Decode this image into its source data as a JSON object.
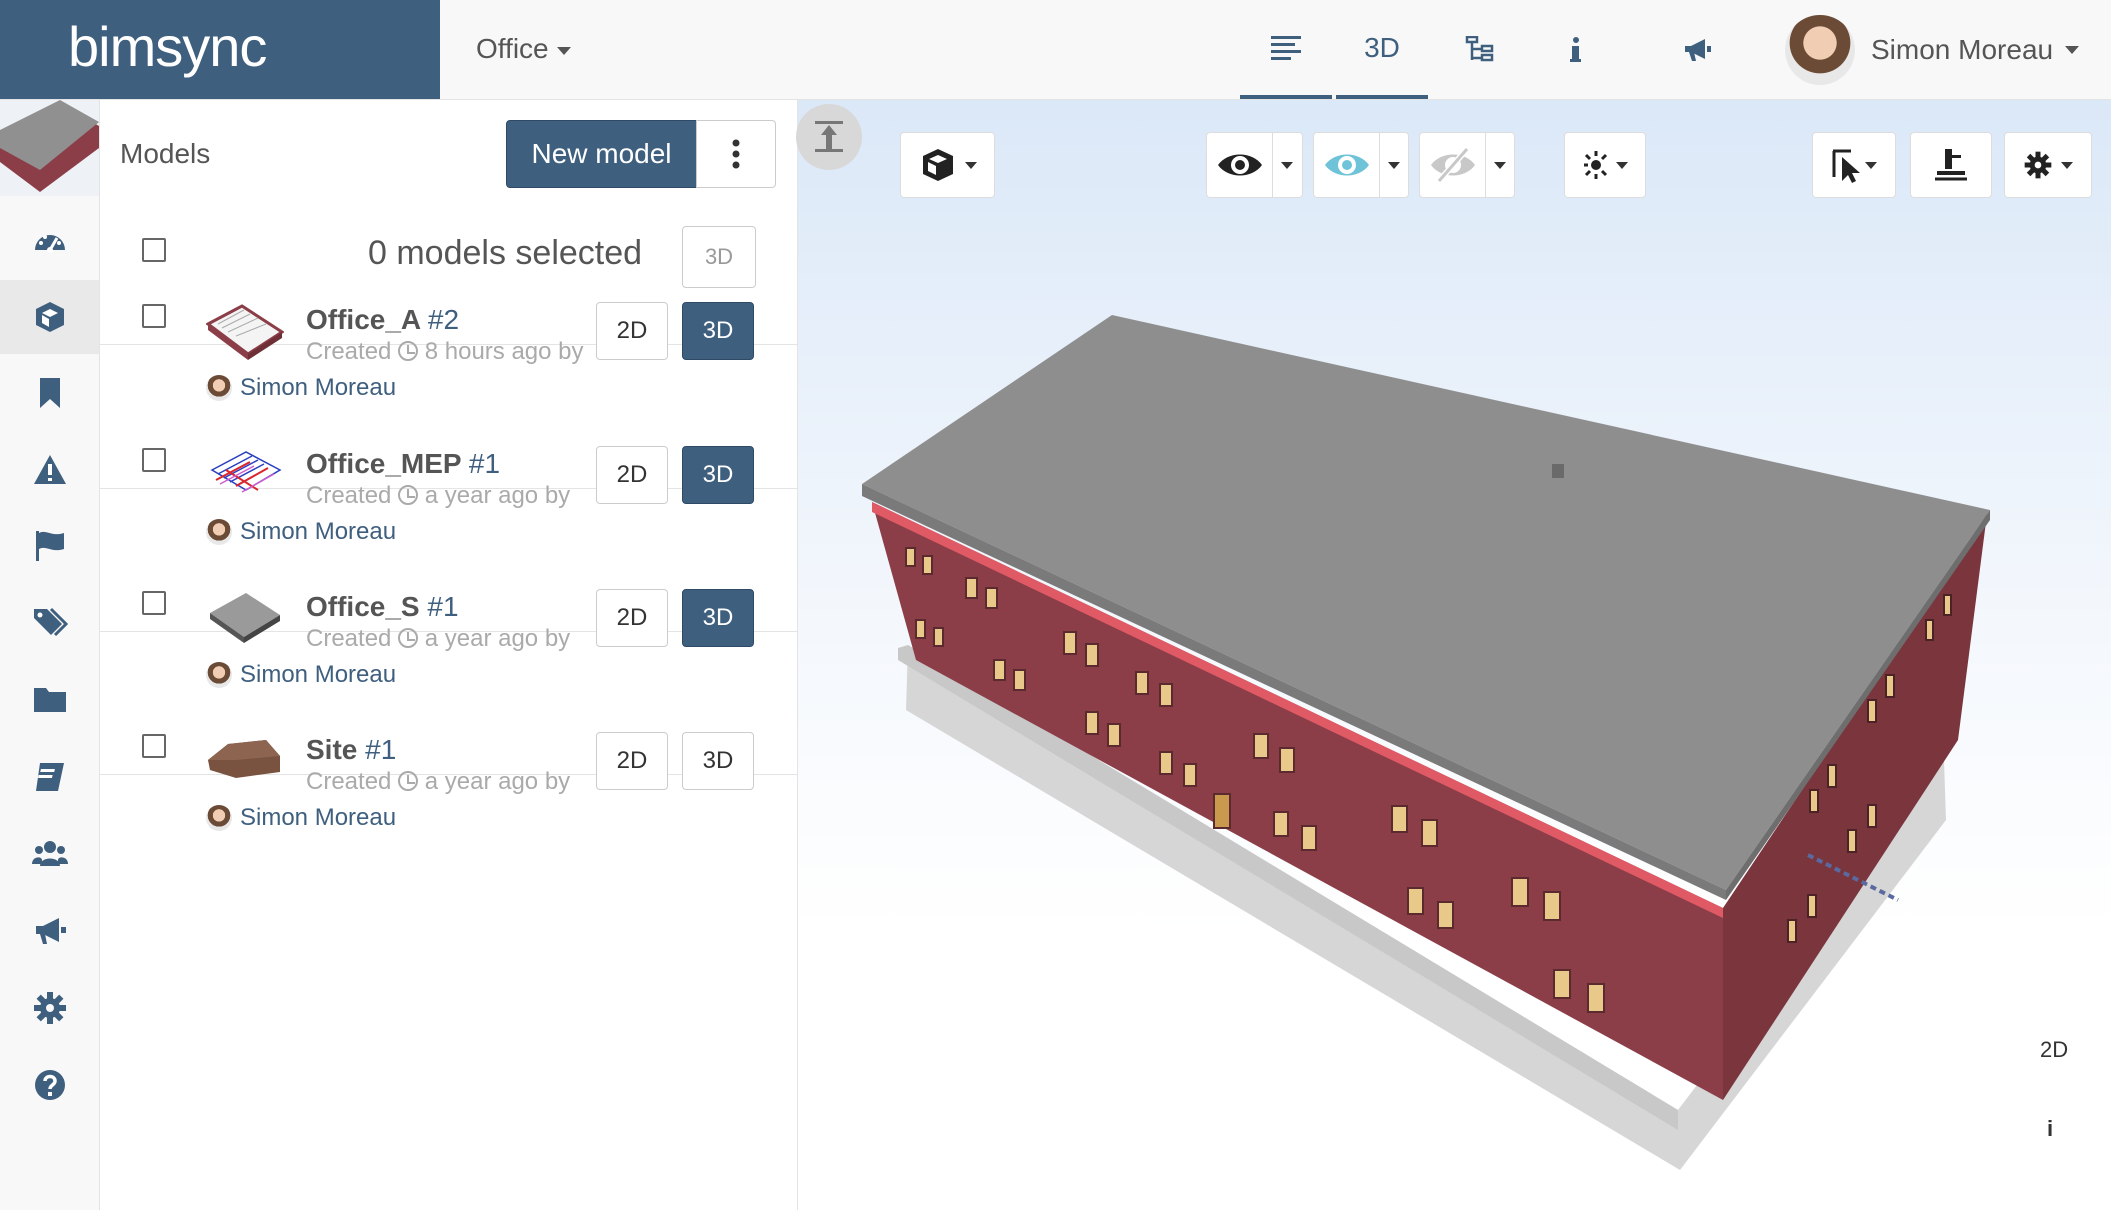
{
  "app": {
    "brand": "bimsync",
    "project": "Office"
  },
  "nav": {
    "tab_3d": "3D"
  },
  "user": {
    "name": "Simon Moreau"
  },
  "panel": {
    "title": "Models",
    "new_model": "New model",
    "selected_count": "0 models selected",
    "bulk_3d": "3D"
  },
  "models": [
    {
      "name": "Office_A",
      "version": "#2",
      "created": "Created",
      "time": "8 hours ago by",
      "author": "Simon Moreau",
      "btn2d": "2D",
      "btn3d": "3D",
      "active3d": true
    },
    {
      "name": "Office_MEP",
      "version": "#1",
      "created": "Created",
      "time": "a year ago by",
      "author": "Simon Moreau",
      "btn2d": "2D",
      "btn3d": "3D",
      "active3d": true
    },
    {
      "name": "Office_S",
      "version": "#1",
      "created": "Created",
      "time": "a year ago by",
      "author": "Simon Moreau",
      "btn2d": "2D",
      "btn3d": "3D",
      "active3d": true
    },
    {
      "name": "Site",
      "version": "#1",
      "created": "Created",
      "time": "a year ago by",
      "author": "Simon Moreau",
      "btn2d": "2D",
      "btn3d": "3D",
      "active3d": false
    }
  ],
  "viewer": {
    "corner_2d": "2D",
    "corner_info": "i"
  },
  "colors": {
    "brand": "#3f5f7f",
    "wall": "#8b3e47",
    "roof": "#8e8e8e"
  }
}
